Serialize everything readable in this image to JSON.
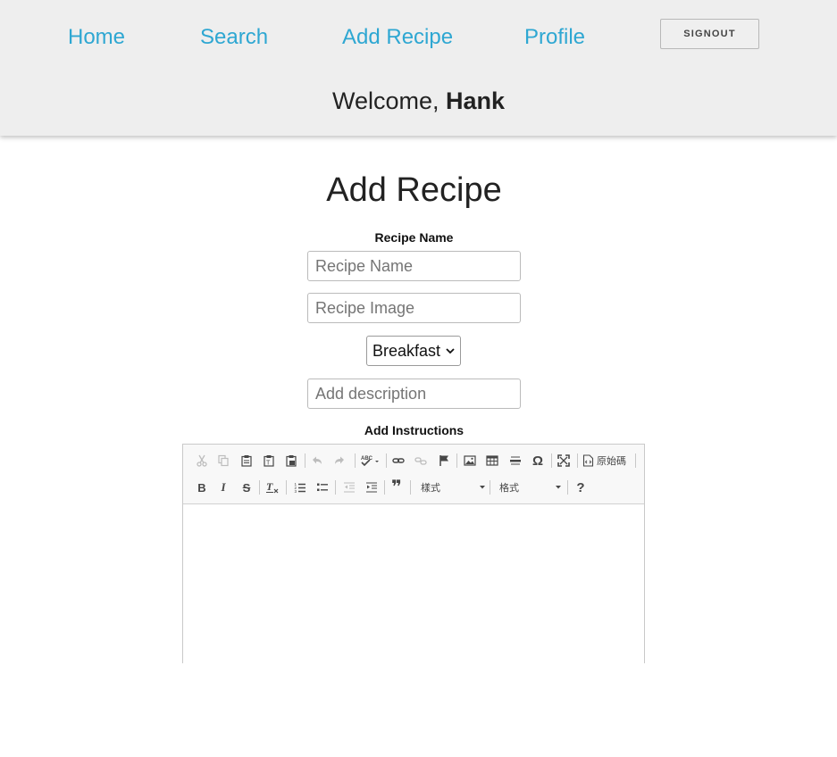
{
  "nav": {
    "home": "Home",
    "search": "Search",
    "add_recipe": "Add Recipe",
    "profile": "Profile",
    "signout": "SIGNOUT"
  },
  "welcome": {
    "prefix": "Welcome, ",
    "name": "Hank"
  },
  "page_title": "Add Recipe",
  "form": {
    "recipe_name_label": "Recipe Name",
    "recipe_name_placeholder": "Recipe Name",
    "recipe_image_placeholder": "Recipe Image",
    "category_selected": "Breakfast",
    "description_placeholder": "Add description",
    "instructions_label": "Add Instructions"
  },
  "editor": {
    "source_label": "原始碼",
    "styles_combo": "樣式",
    "format_combo": "格式",
    "bold": "B",
    "italic": "I",
    "strike": "S",
    "quote": "❞",
    "special_char": "Ω",
    "help": "?"
  },
  "colors": {
    "nav_link": "#2ea7d2",
    "header_bg": "#eeeeee"
  }
}
